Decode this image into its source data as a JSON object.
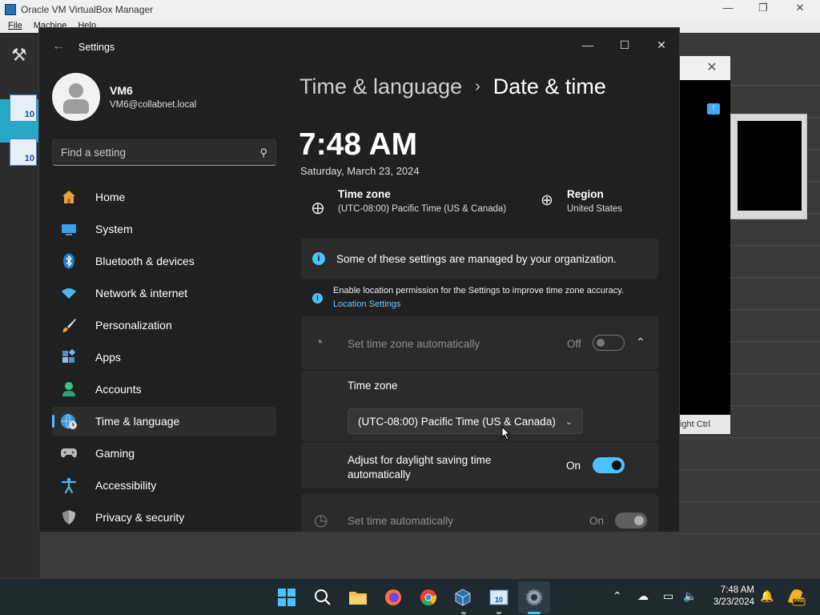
{
  "vbox": {
    "title": "Oracle VM VirtualBox Manager",
    "menu": [
      "File",
      "Machine",
      "Help"
    ],
    "vm_status_text": "ight Ctrl",
    "vm_badge_1": "10",
    "vm_badge_2": "10"
  },
  "settings": {
    "window_title": "Settings",
    "user": {
      "name": "VM6",
      "email": "VM6@collabnet.local"
    },
    "search_placeholder": "Find a setting",
    "nav": [
      {
        "label": "Home",
        "icon": "home-icon"
      },
      {
        "label": "System",
        "icon": "display-icon"
      },
      {
        "label": "Bluetooth & devices",
        "icon": "bluetooth-icon"
      },
      {
        "label": "Network & internet",
        "icon": "wifi-icon"
      },
      {
        "label": "Personalization",
        "icon": "brush-icon"
      },
      {
        "label": "Apps",
        "icon": "apps-icon"
      },
      {
        "label": "Accounts",
        "icon": "person-icon"
      },
      {
        "label": "Time & language",
        "icon": "globe-clock-icon",
        "active": true
      },
      {
        "label": "Gaming",
        "icon": "gamepad-icon"
      },
      {
        "label": "Accessibility",
        "icon": "accessibility-icon"
      },
      {
        "label": "Privacy & security",
        "icon": "shield-icon"
      }
    ],
    "breadcrumb": {
      "parent": "Time & language",
      "separator": "›",
      "current": "Date & time"
    },
    "clock": "7:48 AM",
    "date": "Saturday, March 23, 2024",
    "time_zone": {
      "title": "Time zone",
      "value": "(UTC-08:00) Pacific Time (US & Canada)"
    },
    "region": {
      "title": "Region",
      "value": "United States"
    },
    "org_notice": "Some of these settings are managed by your organization.",
    "location_notice": "Enable location permission for the Settings to improve time zone accuracy.",
    "location_link": "Location Settings",
    "set_tz_auto": {
      "label": "Set time zone automatically",
      "state": "Off"
    },
    "tz_dropdown": {
      "label": "Time zone",
      "selected": "(UTC-08:00) Pacific Time (US & Canada)"
    },
    "dst": {
      "label": "Adjust for daylight saving time automatically",
      "state": "On"
    },
    "set_time_auto": {
      "label": "Set time automatically",
      "state": "On"
    }
  },
  "taskbar": {
    "time": "7:48 AM",
    "date": "3/23/2024",
    "pre_badge": "PRE"
  },
  "colors": {
    "accent": "#4cc2ff",
    "window_bg": "#202020",
    "card_bg": "#2b2b2b"
  }
}
